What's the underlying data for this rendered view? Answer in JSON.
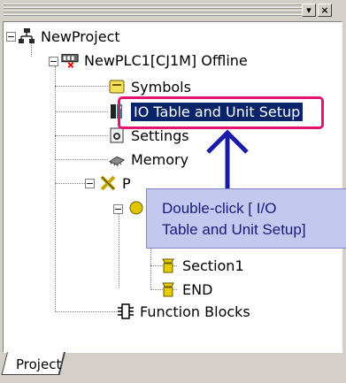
{
  "window": {
    "pin_button": "▾",
    "close_button": "×"
  },
  "tree": {
    "root": "NewProject",
    "plc": "NewPLC1[CJ1M] Offline",
    "items": [
      "Symbols",
      "IO Table and Unit Setup",
      "Settings",
      "Memory",
      "P",
      "Section1",
      "END",
      "Function Blocks"
    ]
  },
  "callout": {
    "line1": "Double-click [ I/O",
    "line2": "Table and Unit Setup]"
  },
  "tabs": {
    "project": "Project"
  },
  "colors": {
    "highlight": "#e2146e",
    "callout_bg": "#c3c8ef",
    "arrow": "#1a1aa8",
    "selection": "#0a246a"
  }
}
